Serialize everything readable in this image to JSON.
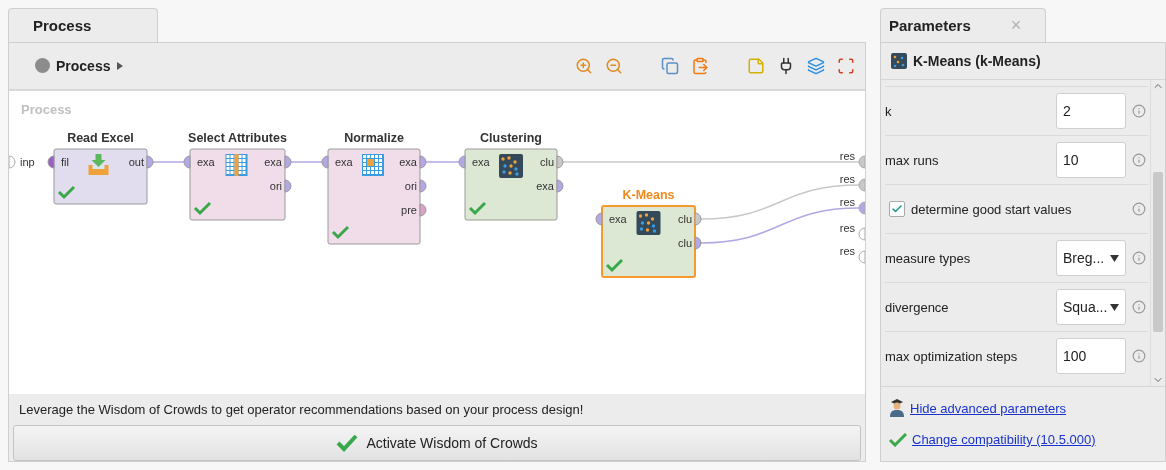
{
  "process_tab": {
    "label": "Process"
  },
  "toolbar": {
    "breadcrumb": "Process"
  },
  "canvas": {
    "label": "Process",
    "input_port": {
      "label": "inp",
      "color": "#ffffff"
    },
    "operators": [
      {
        "name": "Read Excel",
        "selected": false,
        "color": "#e1ddee",
        "kind": "import",
        "ok": true,
        "inputs": [
          {
            "label": "fil",
            "color": "#9c5fc4"
          }
        ],
        "outputs": [
          {
            "label": "out",
            "color": "#b4a7e5"
          }
        ]
      },
      {
        "name": "Select Attributes",
        "selected": false,
        "color": "#f1dcea",
        "kind": "table",
        "ok": true,
        "inputs": [
          {
            "label": "exa",
            "color": "#b4a7e5"
          }
        ],
        "outputs": [
          {
            "label": "exa",
            "color": "#b4a7e5"
          },
          {
            "label": "ori",
            "color": "#b4a7e5"
          }
        ]
      },
      {
        "name": "Normalize",
        "selected": false,
        "color": "#f1dcea",
        "kind": "normalize",
        "ok": true,
        "inputs": [
          {
            "label": "exa",
            "color": "#b4a7e5"
          }
        ],
        "outputs": [
          {
            "label": "exa",
            "color": "#b4a7e5"
          },
          {
            "label": "ori",
            "color": "#b4a7e5"
          },
          {
            "label": "pre",
            "color": "#d9a3c8"
          }
        ]
      },
      {
        "name": "Clustering",
        "selected": false,
        "color": "#dce8d4",
        "kind": "cluster",
        "ok": true,
        "inputs": [
          {
            "label": "exa",
            "color": "#b4a7e5"
          }
        ],
        "outputs": [
          {
            "label": "clu",
            "color": "#c8c8c8"
          },
          {
            "label": "exa",
            "color": "#b4a7e5"
          }
        ]
      },
      {
        "name": "K-Means",
        "selected": true,
        "color": "#dce8d4",
        "kind": "cluster",
        "ok": true,
        "inputs": [
          {
            "label": "exa",
            "color": "#b4a7e5"
          }
        ],
        "outputs": [
          {
            "label": "clu",
            "color": "#c8c8c8"
          },
          {
            "label": "clu",
            "color": "#b4a7e5"
          }
        ]
      }
    ],
    "result_ports": [
      {
        "label": "res",
        "color": "#c8c8c8"
      },
      {
        "label": "res",
        "color": "#c8c8c8"
      },
      {
        "label": "res",
        "color": "#b4a7e5"
      },
      {
        "label": "res",
        "color": "#ffffff"
      },
      {
        "label": "res",
        "color": "#ffffff"
      }
    ]
  },
  "wisdom": {
    "message": "Leverage the Wisdom of Crowds to get operator recommendations based on your process design!",
    "button": "Activate Wisdom of Crowds"
  },
  "parameters_tab": {
    "label": "Parameters",
    "close": "×"
  },
  "operator_header": "K-Means (k-Means)",
  "parameters": [
    {
      "kind": "number",
      "label": "k",
      "value": "2"
    },
    {
      "kind": "number",
      "label": "max runs",
      "value": "10"
    },
    {
      "kind": "checkbox",
      "label": "determine good start values",
      "checked": true
    },
    {
      "kind": "select",
      "label": "measure types",
      "value": "Breg..."
    },
    {
      "kind": "select",
      "label": "divergence",
      "value": "Squa..."
    },
    {
      "kind": "number",
      "label": "max optimization steps",
      "value": "100"
    }
  ],
  "footer_links": [
    {
      "kind": "advanced",
      "text": "Hide advanced parameters"
    },
    {
      "kind": "compat",
      "text": "Change compatibility (10.5.000)"
    }
  ]
}
